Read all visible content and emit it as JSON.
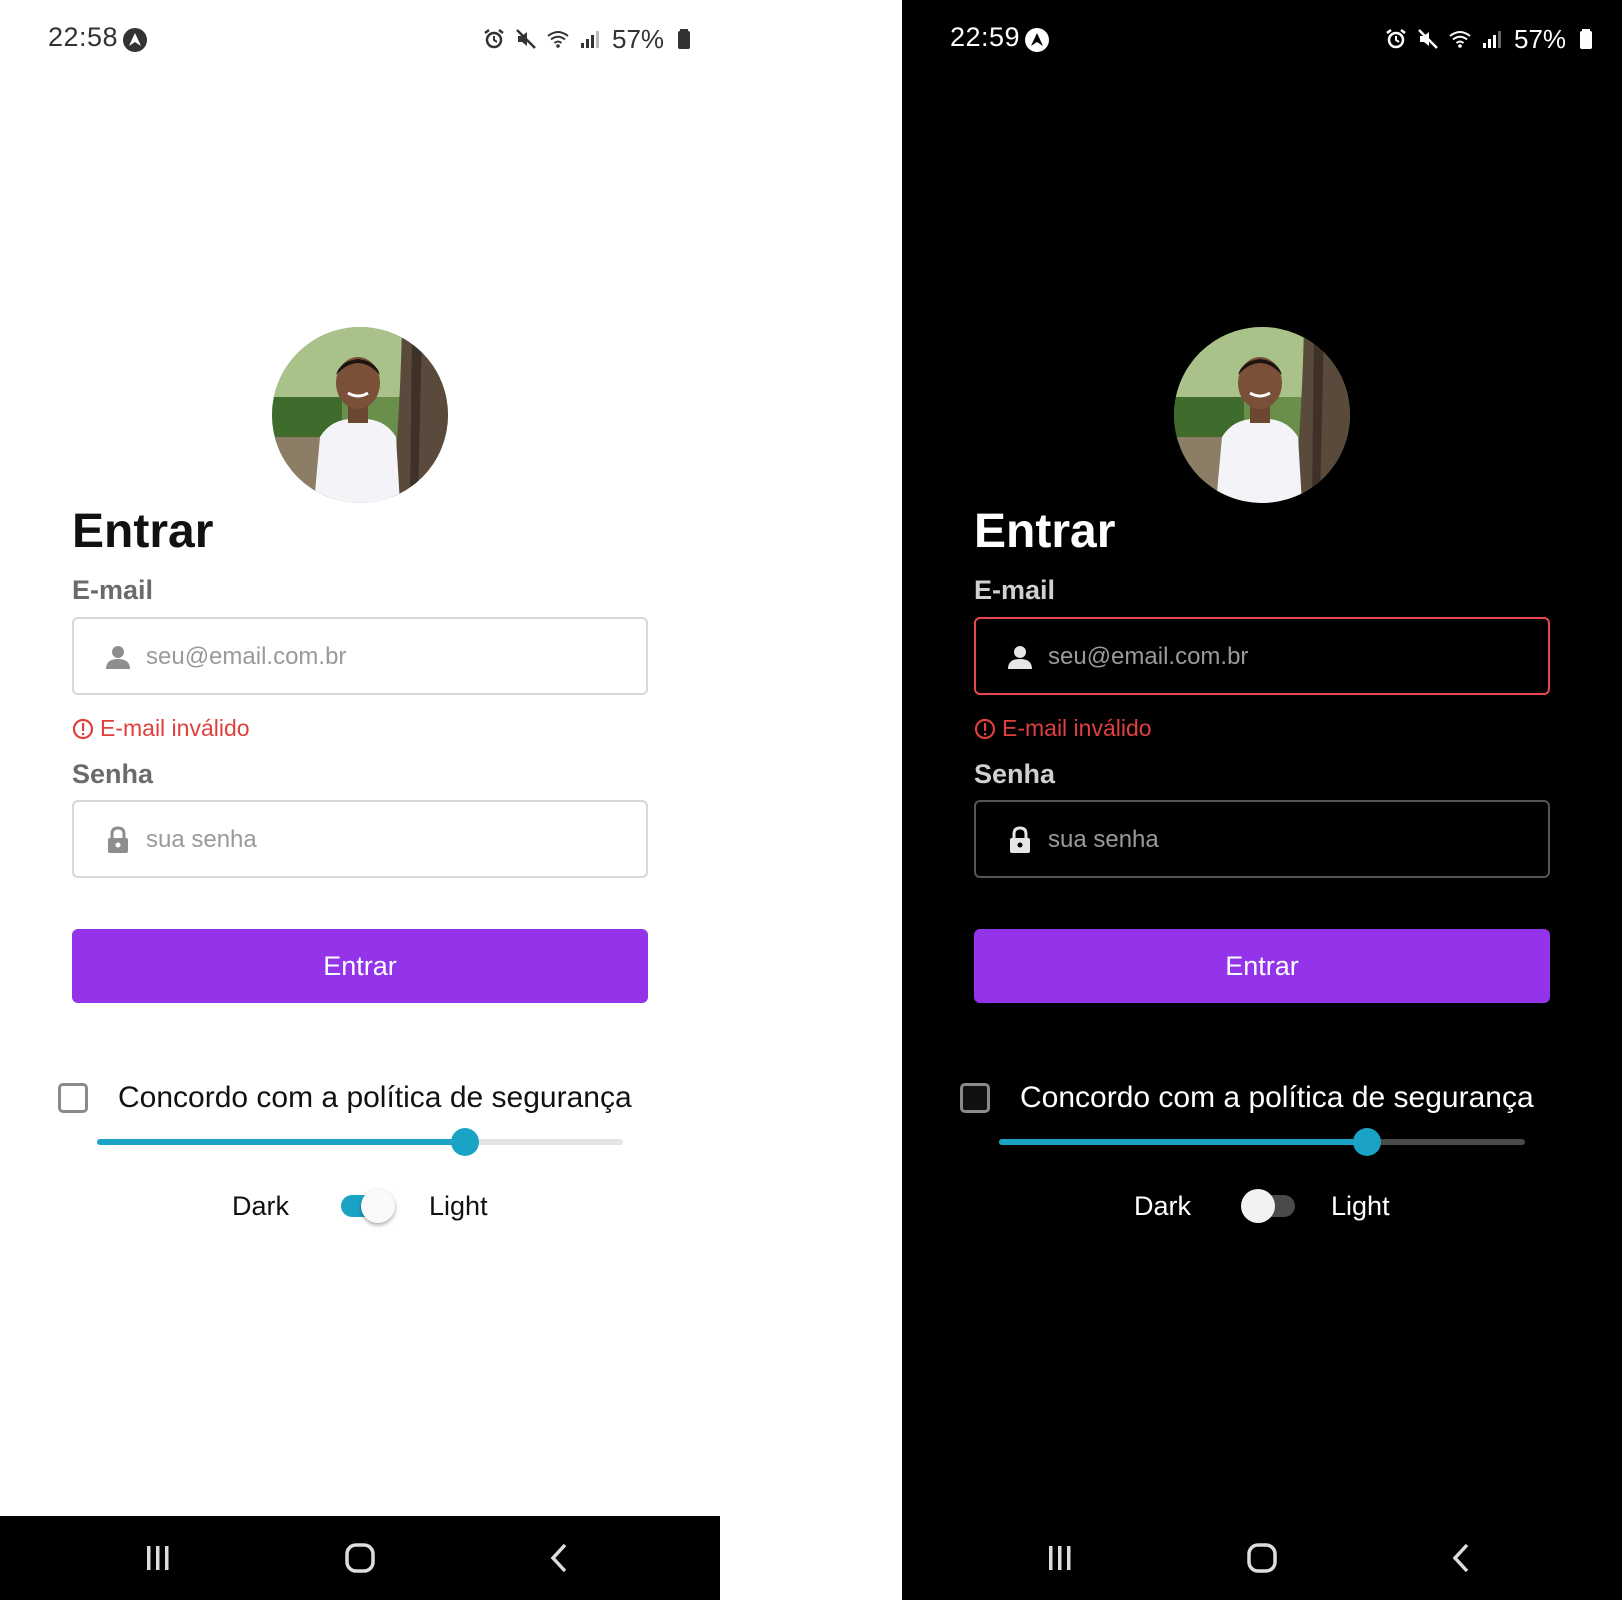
{
  "screens": [
    {
      "theme": "light",
      "status": {
        "time": "22:58",
        "battery": "57%"
      },
      "title": "Entrar",
      "email": {
        "label": "E-mail",
        "placeholder": "seu@email.com.br",
        "error": "E-mail inválido"
      },
      "password": {
        "label": "Senha",
        "placeholder": "sua senha"
      },
      "submit_label": "Entrar",
      "agree": {
        "label": "Concordo com a política de segurança",
        "checked": false
      },
      "slider": {
        "value": 0.7
      },
      "theme_toggle": {
        "dark_label": "Dark",
        "light_label": "Light",
        "on": true
      }
    },
    {
      "theme": "dark",
      "status": {
        "time": "22:59",
        "battery": "57%"
      },
      "title": "Entrar",
      "email": {
        "label": "E-mail",
        "placeholder": "seu@email.com.br",
        "error": "E-mail inválido"
      },
      "password": {
        "label": "Senha",
        "placeholder": "sua senha"
      },
      "submit_label": "Entrar",
      "agree": {
        "label": "Concordo com a política de segurança",
        "checked": false
      },
      "slider": {
        "value": 0.7
      },
      "theme_toggle": {
        "dark_label": "Dark",
        "light_label": "Light",
        "on": false
      }
    }
  ],
  "colors": {
    "primary": "#9333ea",
    "accent": "#1ba3c6",
    "error": "#e0403d"
  },
  "icons": [
    "navigation-app-icon",
    "alarm-icon",
    "mute-icon",
    "wifi-icon",
    "signal-icon",
    "battery-icon",
    "user-icon",
    "lock-icon",
    "error-icon",
    "recents-icon",
    "home-icon",
    "back-icon"
  ]
}
